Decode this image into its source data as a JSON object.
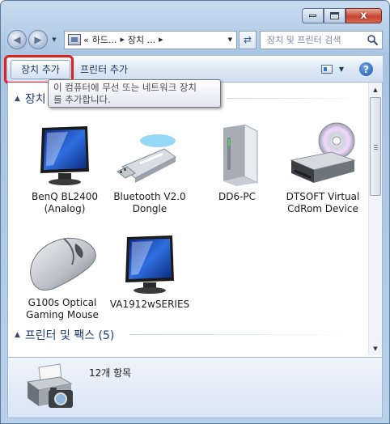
{
  "window": {
    "caption_buttons": [
      {
        "name": "minimize",
        "icon": "minimize-icon"
      },
      {
        "name": "maximize",
        "icon": "maximize-icon"
      },
      {
        "name": "close",
        "icon": "close-icon",
        "glyph": "x"
      }
    ]
  },
  "navbar": {
    "back_icon": "back-arrow-icon",
    "forward_icon": "forward-arrow-icon",
    "address": {
      "prefix": "«",
      "parts": [
        "하드...",
        "장치 ..."
      ]
    },
    "refresh_icon": "refresh-icon",
    "search_placeholder": "장치 및 프린터 검색"
  },
  "toolbar": {
    "add_device_label": "장치 추가",
    "add_printer_label": "프린터 추가",
    "view_icon": "change-view-icon",
    "help_glyph": "?",
    "highlight_color": "#e0201f"
  },
  "tooltip": {
    "line1": "이 컴퓨터에 무선 또는 네트워크 장치",
    "line2": "를 추가합니다."
  },
  "groups": {
    "devices_header": "장치 (6)",
    "printers_header": "프린터 및 팩스 (5)"
  },
  "devices": [
    {
      "name": "monitor",
      "line1": "BenQ BL2400",
      "line2": "(Analog)"
    },
    {
      "name": "bluetooth",
      "line1": "Bluetooth V2.0",
      "line2": "Dongle"
    },
    {
      "name": "external-drive",
      "line1": "DD6-PC",
      "line2": ""
    },
    {
      "name": "cdrom",
      "line1": "DTSOFT Virtual",
      "line2": "CdRom Device"
    },
    {
      "name": "mouse",
      "line1": "G100s Optical",
      "line2": "Gaming Mouse"
    },
    {
      "name": "monitor2",
      "line1": "VA1912wSERIES",
      "line2": ""
    }
  ],
  "details": {
    "count_text": "12개 항목",
    "icon": "printer-camera-icon"
  },
  "colors": {
    "accent_blue": "#1e3a78",
    "toolbar_text": "#1e395b",
    "close_red": "#c7432f"
  }
}
